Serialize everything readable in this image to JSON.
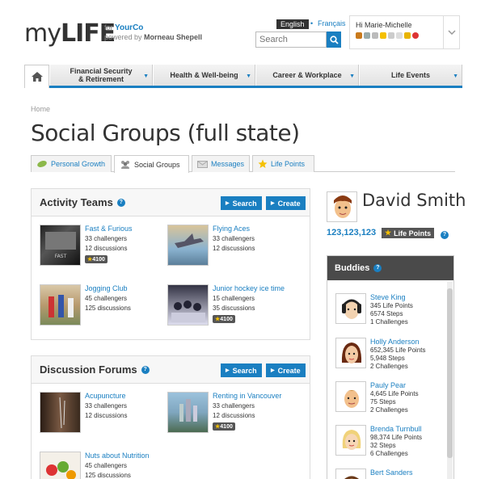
{
  "header": {
    "logo_my": "my",
    "logo_life": "LIFE",
    "for_label": "for",
    "company": "YourCo",
    "powered_label": "powered by",
    "powered_company": "Morneau Shepell",
    "lang_current": "English",
    "lang_separator": "•",
    "lang_other": "Français",
    "search_placeholder": "Search",
    "greeting_prefix": "Hi",
    "user_name": "Marie-Michelle"
  },
  "nav": {
    "items": [
      {
        "label_1": "Financial Security",
        "label_2": "& Retirement"
      },
      {
        "label_1": "Health & Well-being",
        "label_2": ""
      },
      {
        "label_1": "Career & Workplace",
        "label_2": ""
      },
      {
        "label_1": "Life Events",
        "label_2": ""
      }
    ]
  },
  "breadcrumb": "Home",
  "page_title": "Social Groups (full state)",
  "tabs": [
    {
      "label": "Personal Growth",
      "active": false
    },
    {
      "label": "Social Groups",
      "active": true
    },
    {
      "label": "Messages",
      "active": false
    },
    {
      "label": "Life Points",
      "active": false
    }
  ],
  "activity_teams": {
    "title": "Activity Teams",
    "search_label": "Search",
    "create_label": "Create",
    "items": [
      {
        "name": "Fast & Furious",
        "line1": "33 challengers",
        "line2": "12 discussions",
        "badge": "4100"
      },
      {
        "name": "Flying Aces",
        "line1": "33 challengers",
        "line2": "12 discussions",
        "badge": ""
      },
      {
        "name": "Jogging Club",
        "line1": "45 challengers",
        "line2": "125 discussions",
        "badge": ""
      },
      {
        "name": "Junior hockey ice time",
        "line1": "15 challengers",
        "line2": "35 discussions",
        "badge": "4100"
      }
    ]
  },
  "discussion_forums": {
    "title": "Discussion Forums",
    "search_label": "Search",
    "create_label": "Create",
    "items": [
      {
        "name": "Acupuncture",
        "line1": "33 challengers",
        "line2": "12 discussions",
        "badge": ""
      },
      {
        "name": "Renting in Vancouver",
        "line1": "33 challengers",
        "line2": "12 discussions",
        "badge": "4100"
      },
      {
        "name": "Nuts about Nutrition",
        "line1": "45 challengers",
        "line2": "125 discussions",
        "badge": ""
      }
    ]
  },
  "profile": {
    "name": "David Smith",
    "life_points": "123,123,123",
    "life_points_label": "Life Points"
  },
  "buddies": {
    "title": "Buddies",
    "items": [
      {
        "name": "Steve King",
        "points": "345 Life Points",
        "steps": "6574 Steps",
        "challenges": "1 Challenges"
      },
      {
        "name": "Holly Anderson",
        "points": "652,345 Life Points",
        "steps": "5,948 Steps",
        "challenges": "2 Challenges"
      },
      {
        "name": "Pauly Pear",
        "points": "4,645 Life Points",
        "steps": "75 Steps",
        "challenges": "2 Challenges"
      },
      {
        "name": "Brenda Turnbull",
        "points": "98,374 Life Points",
        "steps": "32 Steps",
        "challenges": "6 Challenges"
      },
      {
        "name": "Bert Sanders",
        "points": "",
        "steps": "",
        "challenges": ""
      }
    ]
  },
  "colors": {
    "brand_blue": "#1a7fc1",
    "dark_gray": "#4a4a4a",
    "star_gold": "#f5c000"
  }
}
